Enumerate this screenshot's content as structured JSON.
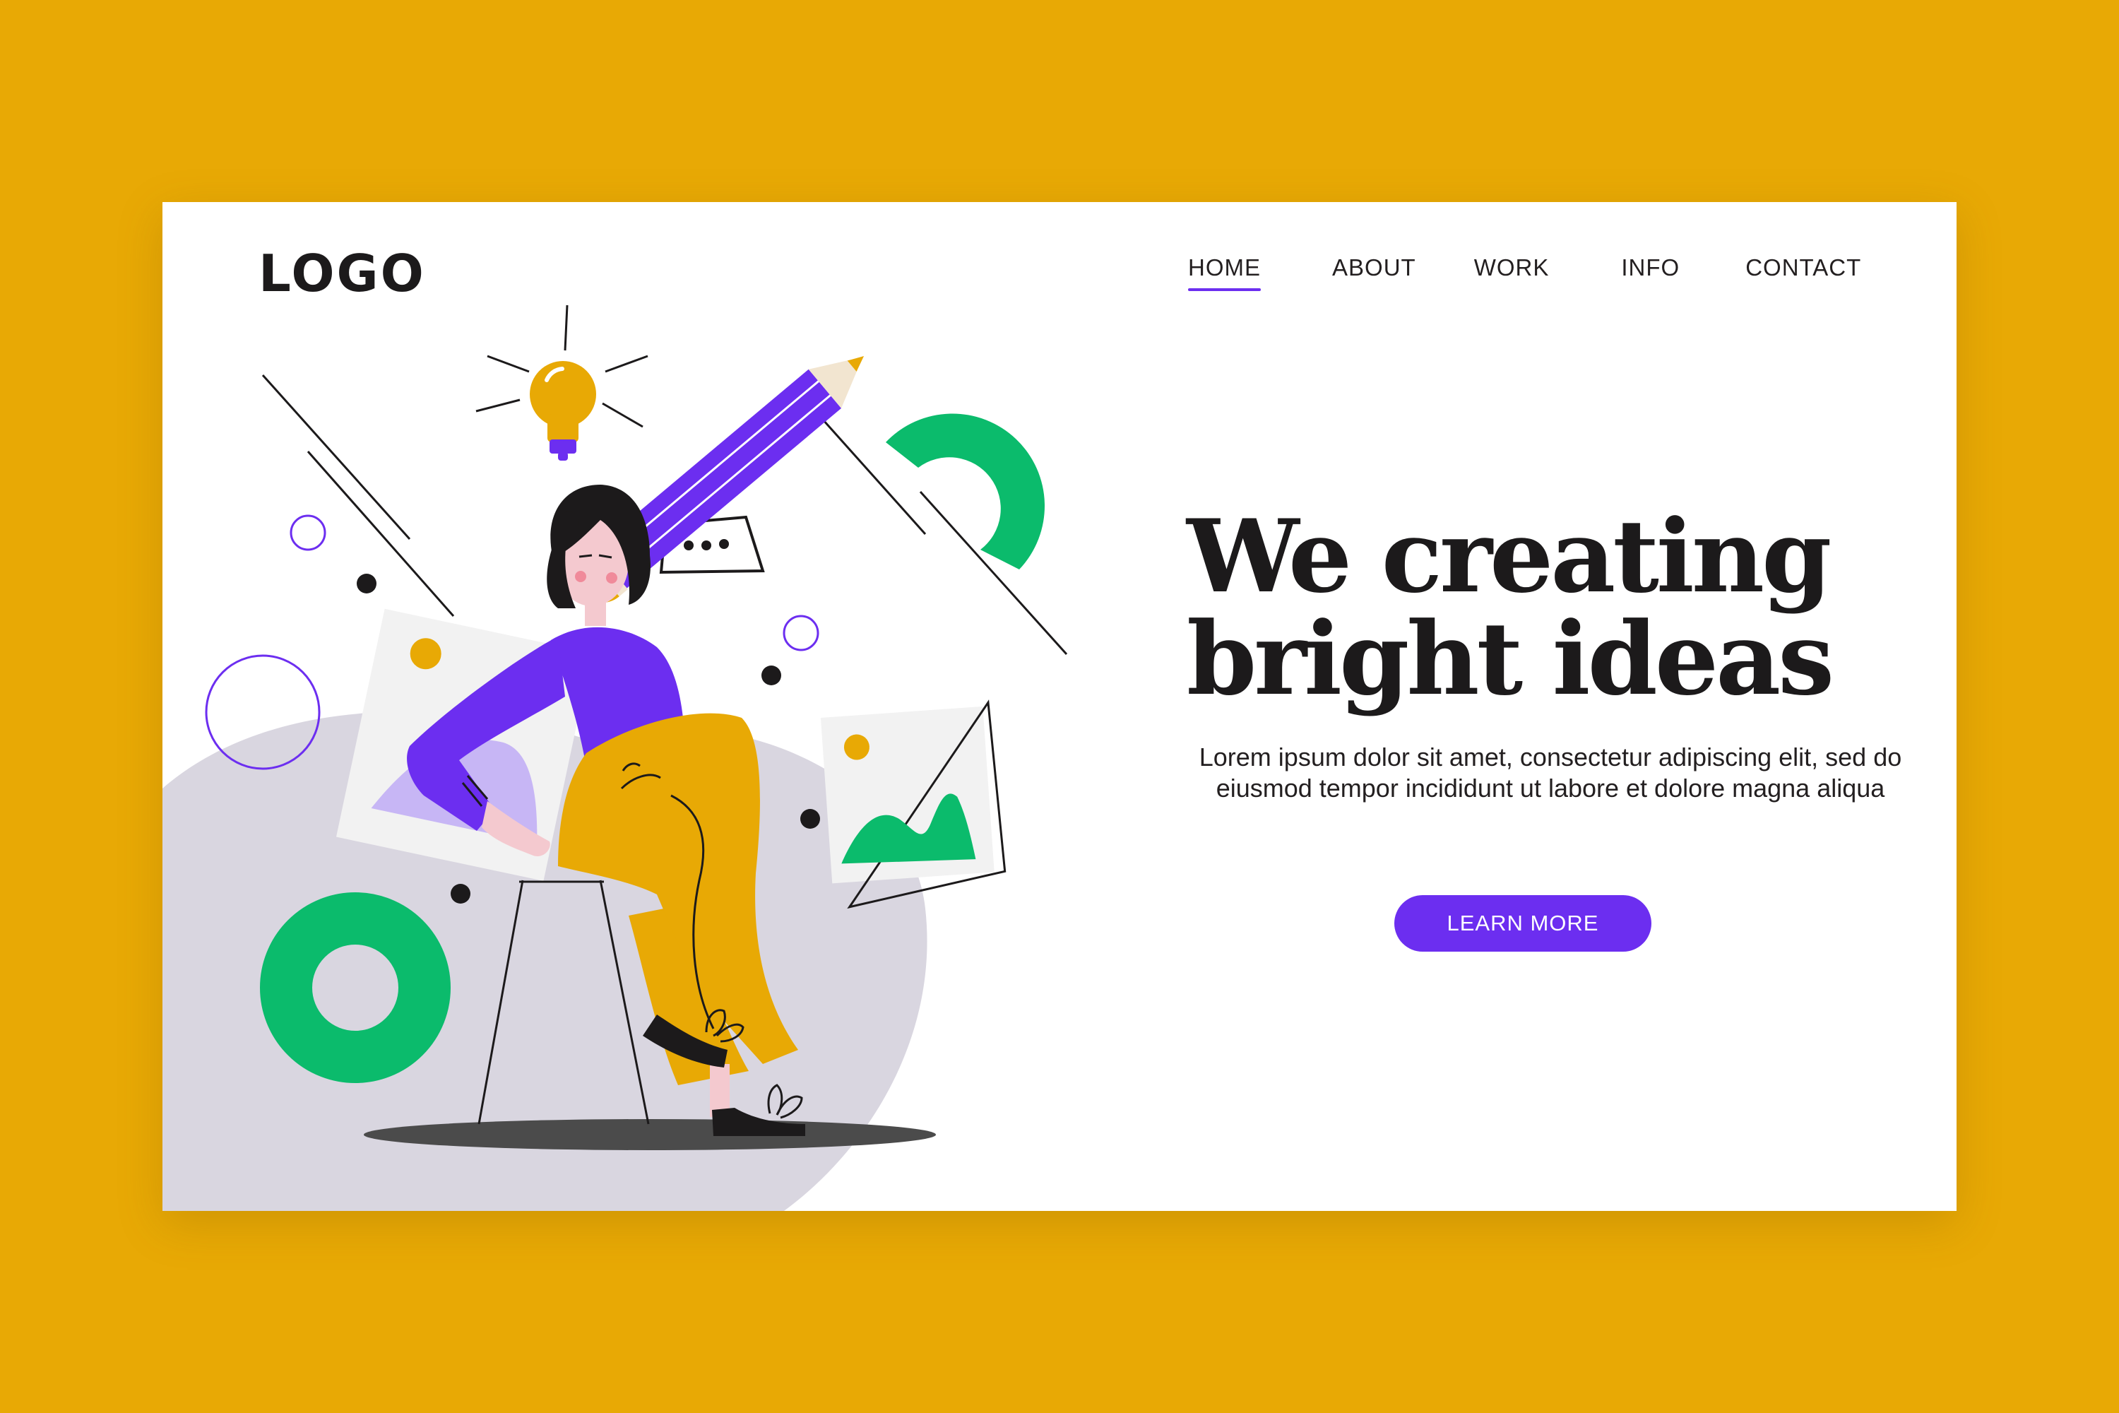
{
  "header": {
    "logo": "LOGO",
    "nav": [
      {
        "label": "HOME",
        "active": true
      },
      {
        "label": "ABOUT",
        "active": false
      },
      {
        "label": "WORK",
        "active": false
      },
      {
        "label": "INFO",
        "active": false
      },
      {
        "label": "CONTACT",
        "active": false
      }
    ]
  },
  "hero": {
    "headline_line1": "We creating",
    "headline_line2": "bright ideas",
    "body": "Lorem ipsum dolor sit amet, consectetur adipiscing elit, sed do eiusmod tempor incididunt ut labore et dolore magna aliqua",
    "cta_label": "LEARN MORE"
  },
  "colors": {
    "page_background": "#E8A905",
    "card_background": "#FFFFFF",
    "accent_purple": "#6C2EF0",
    "accent_green": "#0BBB6C",
    "accent_yellow": "#E8A905",
    "blob_gray": "#D9D6E0",
    "text_dark": "#1C1A1B"
  },
  "icons": [
    "lightbulb-icon",
    "pencil-icon",
    "speech-bubble-icon",
    "image-frame-icon",
    "green-ring-icon",
    "green-arc-icon"
  ]
}
